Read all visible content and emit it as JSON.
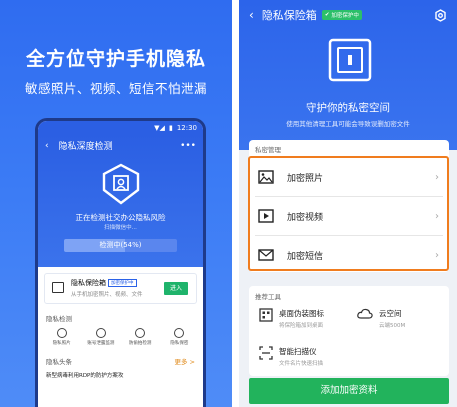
{
  "left": {
    "headline": "全方位守护手机隐私",
    "subheadline": "敏感照片、视频、短信不怕泄漏",
    "phone": {
      "time": "12:30",
      "title": "隐私深度检测",
      "more": "•••",
      "scan_text": "正在检测社交办公隐私风险",
      "scan_sub": "扫描微信中...",
      "progress_label": "检测中(54%)",
      "progress_fraction": 0.54,
      "card_title": "隐私保险箱",
      "card_tag": "加密保护中",
      "card_sub": "从手机加密照片、视频、文件",
      "card_button": "进入",
      "section_title": "隐私检测",
      "icons": [
        "隐私照片",
        "账号泄露监测",
        "防偷拍检测",
        "隐私保密"
      ],
      "news_title": "隐私头条",
      "news_more": "更多 >",
      "article": "新型病毒利用RDP的防护方案攻"
    }
  },
  "right": {
    "title": "隐私保险箱",
    "badge": "加密保护中",
    "heading": "守护你的私密空间",
    "subheading": "使用其他清理工具可能会导致误删加密文件",
    "list_caption": "私密管理",
    "rows": [
      {
        "label": "加密照片",
        "icon": "photo-icon"
      },
      {
        "label": "加密视频",
        "icon": "video-icon"
      },
      {
        "label": "加密短信",
        "icon": "message-icon"
      }
    ],
    "tools_caption": "推荐工具",
    "tools": [
      {
        "name": "桌面伪装图标",
        "desc": "将保险箱加到桌面",
        "icon": "disguise-icon"
      },
      {
        "name": "云空间",
        "desc": "云端500M",
        "icon": "cloud-icon"
      },
      {
        "name": "智能扫描仪",
        "desc": "文件名片快速扫描",
        "icon": "scanner-icon"
      }
    ],
    "add_button": "添加加密资料",
    "colors": {
      "primary": "#2c64ea",
      "highlight": "#f07c1e",
      "success": "#22b35c"
    }
  }
}
